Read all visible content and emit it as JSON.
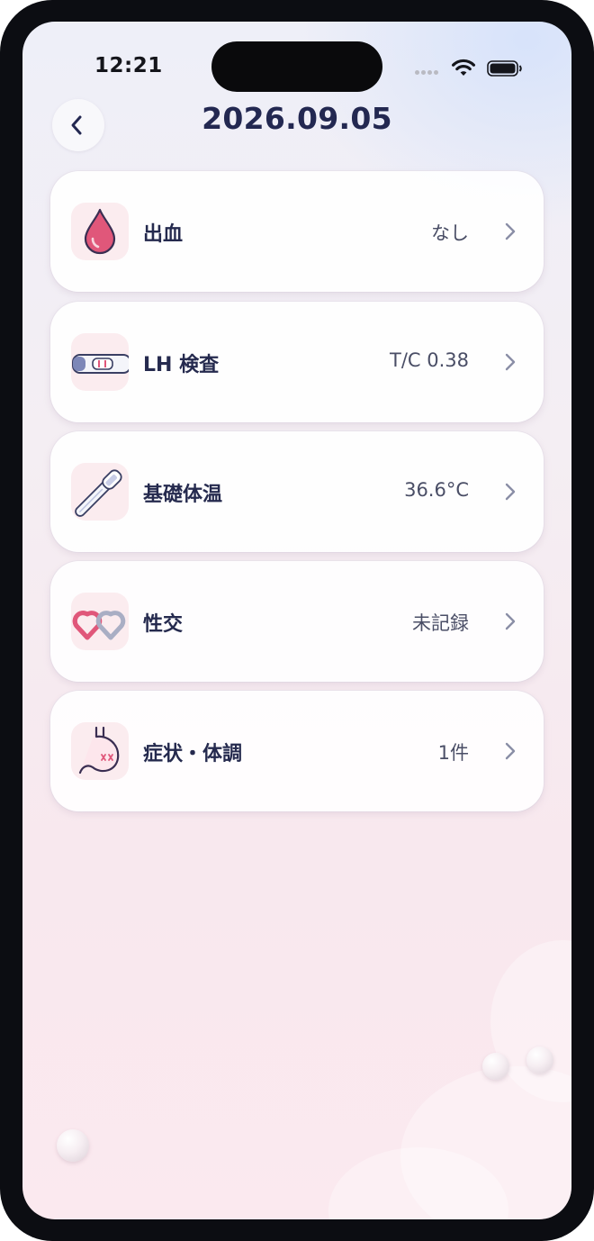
{
  "status_bar": {
    "time": "12:21",
    "icons": [
      "signal-dots-icon",
      "wifi-icon",
      "battery-icon"
    ]
  },
  "header": {
    "title": "2026.09.05",
    "back_icon": "chevron-left-icon"
  },
  "records": [
    {
      "label": "出血",
      "value": "なし",
      "icon": "blood-drop-icon"
    },
    {
      "label": "LH 検査",
      "value": "T/C 0.38",
      "icon": "test-strip-icon"
    },
    {
      "label": "基礎体温",
      "value": "36.6°C",
      "icon": "thermometer-icon"
    },
    {
      "label": "性交",
      "value": "未記録",
      "icon": "linked-hearts-icon"
    },
    {
      "label": "症状・体調",
      "value": "1件",
      "icon": "stomach-icon"
    }
  ],
  "colors": {
    "title": "#232851",
    "label": "#252a4e",
    "value": "#4a4e66",
    "icon_bg": "#fbecef",
    "accent_pink": "#e0577a"
  }
}
